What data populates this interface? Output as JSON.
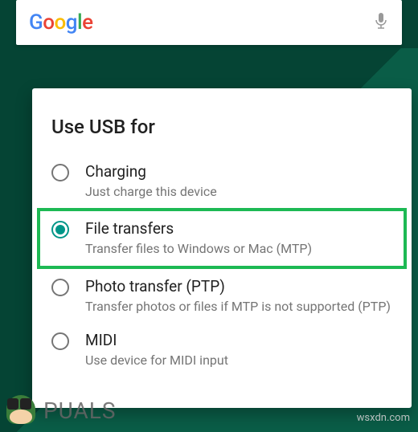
{
  "search": {
    "logo_g1": "G",
    "logo_o1": "o",
    "logo_o2": "o",
    "logo_g2": "g",
    "logo_l": "l",
    "logo_e": "e"
  },
  "dialog": {
    "title": "Use USB for",
    "options": [
      {
        "title": "Charging",
        "sub": "Just charge this device",
        "selected": false,
        "highlighted": false
      },
      {
        "title": "File transfers",
        "sub": "Transfer files to Windows or Mac (MTP)",
        "selected": true,
        "highlighted": true
      },
      {
        "title": "Photo transfer (PTP)",
        "sub": "Transfer photos or files if MTP is not supported (PTP)",
        "selected": false,
        "highlighted": false
      },
      {
        "title": "MIDI",
        "sub": "Use device for MIDI input",
        "selected": false,
        "highlighted": false
      }
    ]
  },
  "watermark": {
    "left": "PUALS",
    "right": "wsxdn.com"
  }
}
